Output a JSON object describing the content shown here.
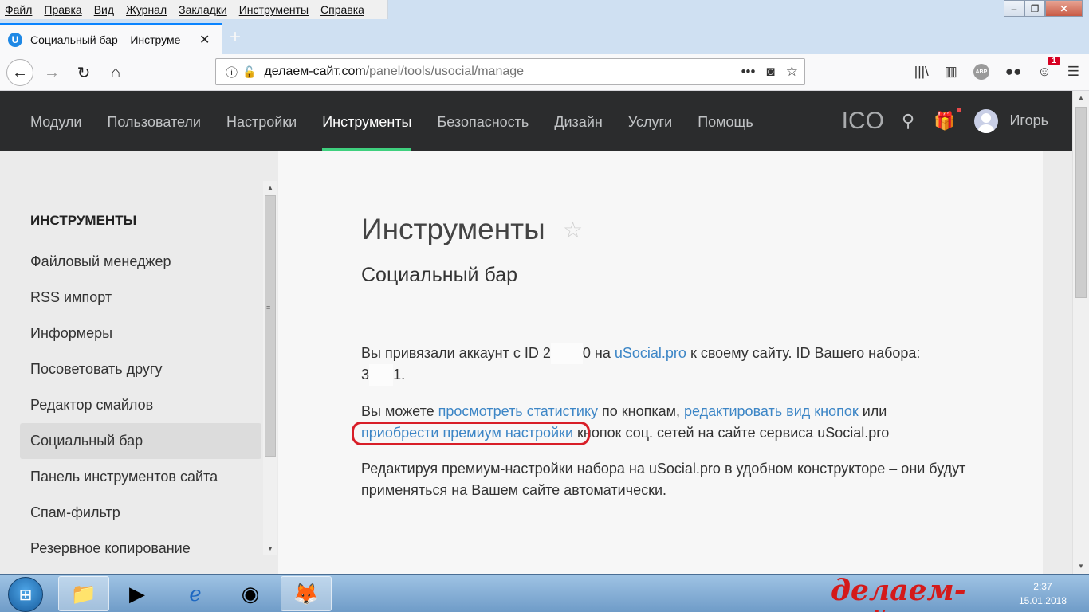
{
  "menubar": [
    "Файл",
    "Правка",
    "Вид",
    "Журнал",
    "Закладки",
    "Инструменты",
    "Справка"
  ],
  "tab": {
    "favicon_letter": "U",
    "title": "Социальный бар – Инструме"
  },
  "url": {
    "host": "делаем-сайт.com",
    "path": "/panel/tools/usocial/manage"
  },
  "toolbar": {
    "notification_count": "1",
    "abp_label": "ABP"
  },
  "site_nav": [
    "Модули",
    "Пользователи",
    "Настройки",
    "Инструменты",
    "Безопасность",
    "Дизайн",
    "Услуги",
    "Помощь"
  ],
  "header": {
    "ico_label": "ICO",
    "username": "Игорь"
  },
  "sidebar": {
    "title": "ИНСТРУМЕНТЫ",
    "items": [
      "Файловый менеджер",
      "RSS импорт",
      "Информеры",
      "Посоветовать другу",
      "Редактор смайлов",
      "Социальный бар",
      "Панель инструментов сайта",
      "Спам-фильтр",
      "Резервное копирование"
    ]
  },
  "content": {
    "title": "Инструменты",
    "subtitle": "Социальный бар",
    "p1_a": "Вы привязали аккаунт с ID 2",
    "p1_b": "0 на ",
    "p1_link": "uSocial.pro",
    "p1_c": " к своему сайту. ID Вашего набора:",
    "p1_d": "3",
    "p1_e": "1.",
    "p2_a": "Вы можете ",
    "p2_link1": "просмотреть статистику",
    "p2_b": " по кнопкам, ",
    "p2_link2": "редактировать вид кнопок",
    "p2_c": " или",
    "p2_link3": "приобрести премиум настройки",
    "p2_d": " кнопок соц. сетей на сайте сервиса uSocial.pro",
    "p3": "Редактируя премиум-настройки набора на uSocial.pro в удобном конструкторе – они будут применяться на Вашем сайте автоматически."
  },
  "taskbar": {
    "watermark": "делаем-сайт.com",
    "time": "2:37",
    "date": "15.01.2018"
  },
  "colors": {
    "accent_green": "#3fd07e",
    "link_blue": "#3d86c6",
    "highlight_red": "#d81e28"
  }
}
